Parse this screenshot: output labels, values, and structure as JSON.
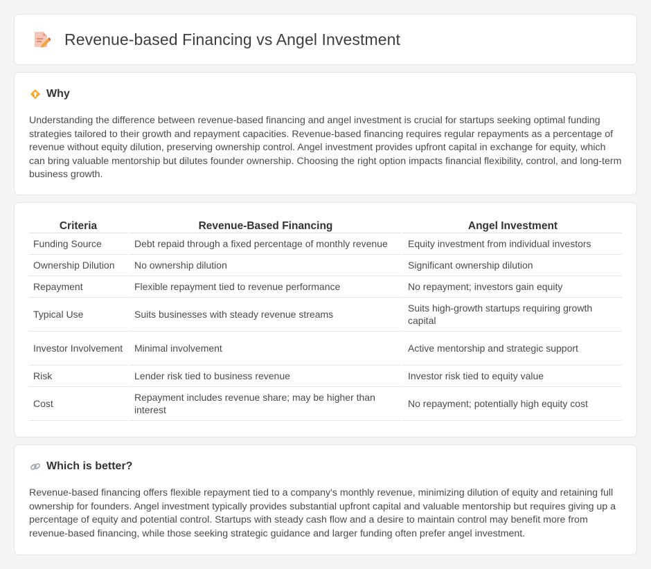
{
  "header": {
    "title": "Revenue-based Financing vs Angel Investment",
    "icon": "document-pencil-icon"
  },
  "why": {
    "heading": "Why",
    "icon": "diamond-bulb-icon",
    "text": "Understanding the difference between revenue-based financing and angel investment is crucial for startups seeking optimal funding strategies tailored to their growth and repayment capacities. Revenue-based financing requires regular repayments as a percentage of revenue without equity dilution, preserving ownership control. Angel investment provides upfront capital in exchange for equity, which can bring valuable mentorship but dilutes founder ownership. Choosing the right option impacts financial flexibility, control, and long-term business growth."
  },
  "table": {
    "headers": [
      "Criteria",
      "Revenue-Based Financing",
      "Angel Investment"
    ],
    "rows": [
      [
        "Funding Source",
        "Debt repaid through a fixed percentage of monthly revenue",
        "Equity investment from individual investors"
      ],
      [
        "Ownership Dilution",
        "No ownership dilution",
        "Significant ownership dilution"
      ],
      [
        "Repayment",
        "Flexible repayment tied to revenue performance",
        "No repayment; investors gain equity"
      ],
      [
        "Typical Use",
        "Suits businesses with steady revenue streams",
        "Suits high-growth startups requiring growth capital"
      ],
      [
        "Investor Involvement",
        "Minimal involvement",
        "Active mentorship and strategic support"
      ],
      [
        "Risk",
        "Lender risk tied to business revenue",
        "Investor risk tied to equity value"
      ],
      [
        "Cost",
        "Repayment includes revenue share; may be higher than interest",
        "No repayment; potentially high equity cost"
      ]
    ]
  },
  "better": {
    "heading": "Which is better?",
    "icon": "link-icon",
    "text": "Revenue-based financing offers flexible repayment tied to a company's monthly revenue, minimizing dilution of equity and retaining full ownership for founders. Angel investment typically provides substantial upfront capital and valuable mentorship but requires giving up a percentage of equity and potential control. Startups with steady cash flow and a desire to maintain control may benefit more from revenue-based financing, while those seeking strategic guidance and larger funding often prefer angel investment."
  }
}
